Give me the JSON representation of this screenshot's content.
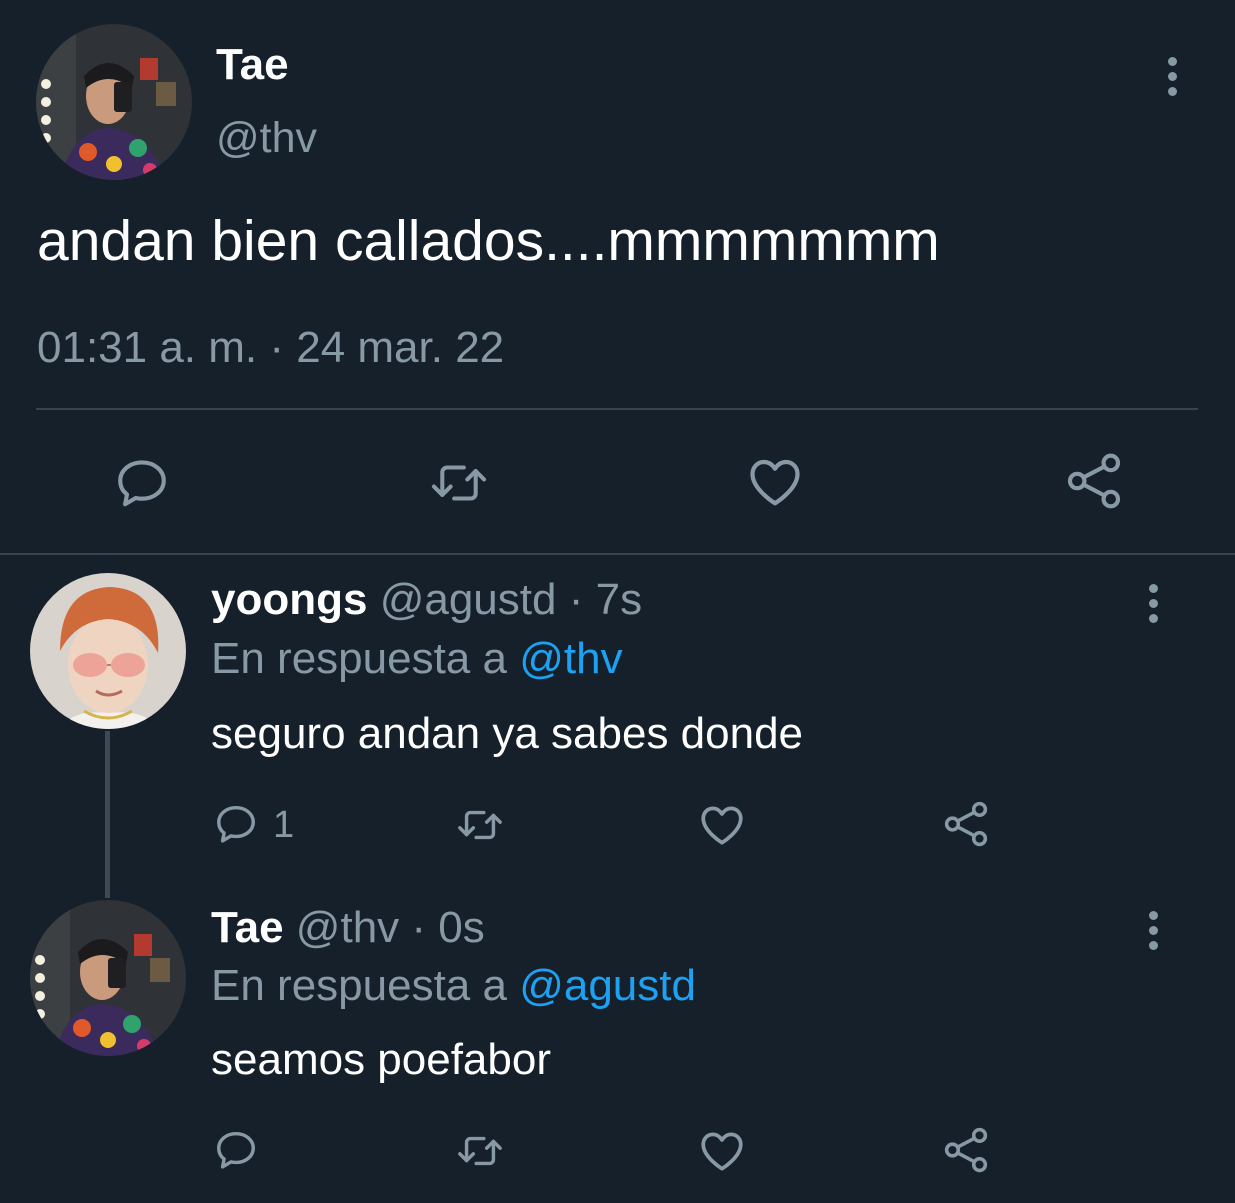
{
  "main_tweet": {
    "display_name": "Tae",
    "handle": "@thv",
    "text": "andan bien callados....mmmmmmm",
    "timestamp": "01:31 a. m. · 24 mar. 22",
    "avatar": "tae-avatar-photo"
  },
  "replies": [
    {
      "display_name": "yoongs",
      "handle": "@agustd",
      "separator": "·",
      "time": "7s",
      "reply_prefix": "En respuesta a",
      "reply_to": "@thv",
      "text": "seguro andan ya sabes donde",
      "reply_count": "1",
      "avatar": "yoongs-avatar-photo"
    },
    {
      "display_name": "Tae",
      "handle": "@thv",
      "separator": "·",
      "time": "0s",
      "reply_prefix": "En respuesta a",
      "reply_to": "@agustd",
      "text": "seamos poefabor",
      "reply_count": "",
      "avatar": "tae-avatar-photo"
    }
  ],
  "icons": {
    "reply": "speech-bubble-icon",
    "retweet": "retweet-icon",
    "like": "heart-icon",
    "share": "share-icon",
    "more": "vertical-dots-icon"
  },
  "colors": {
    "background": "#15202b",
    "muted": "#8899a6",
    "link": "#1da1f2",
    "divider": "#38444d"
  }
}
